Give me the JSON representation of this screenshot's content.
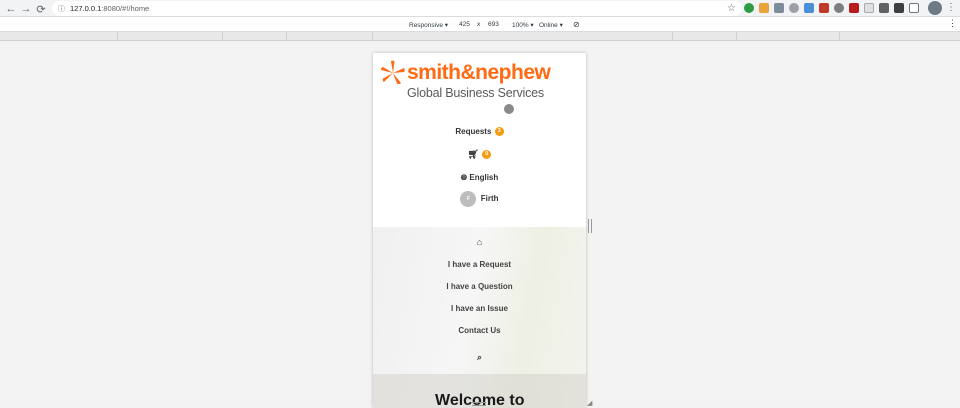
{
  "browser": {
    "url_host": "127.0.0.1",
    "url_rest": ":8080/#!/home"
  },
  "devtools": {
    "device": "Responsive ▾",
    "width": "425",
    "times": "x",
    "height": "693",
    "zoom": "100% ▾",
    "network": "Online ▾"
  },
  "site": {
    "brand": "smith&nephew",
    "subtitle": "Global Business Services",
    "requests_label": "Requests",
    "requests_count": "3",
    "cart_count": "0",
    "language": "English",
    "user_initial": "F",
    "user_name": "Firth"
  },
  "menu": {
    "items": [
      "I have a Request",
      "I have a Question",
      "I have an Issue",
      "Contact Us"
    ]
  },
  "hero": {
    "welcome": "Welcome to"
  },
  "colors": {
    "brand_orange": "#ff6a13",
    "badge": "#f39c12"
  }
}
